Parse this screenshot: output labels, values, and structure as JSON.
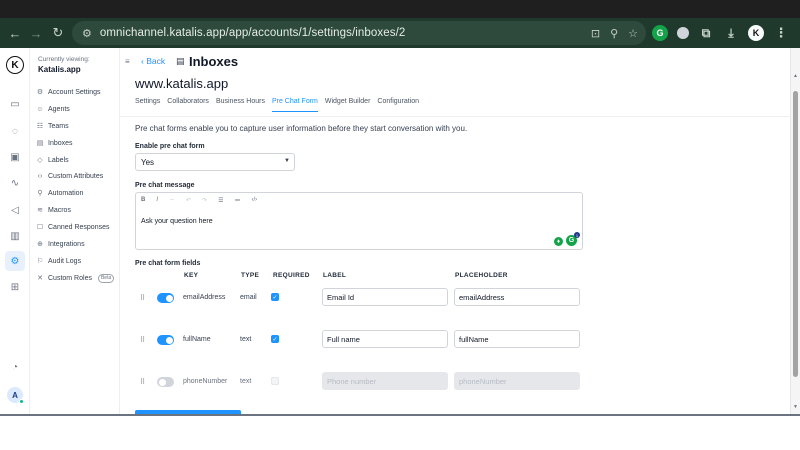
{
  "browser": {
    "url": "omnichannel.katalis.app/app/accounts/1/settings/inboxes/2"
  },
  "rail": {
    "logo_letter": "K",
    "avatar_letter": "A"
  },
  "sidebar": {
    "viewing_label": "Currently viewing:",
    "account_name": "Katalis.app",
    "items": [
      {
        "label": "Account Settings",
        "icon": "⚙"
      },
      {
        "label": "Agents",
        "icon": "☺"
      },
      {
        "label": "Teams",
        "icon": "☷"
      },
      {
        "label": "Inboxes",
        "icon": "▤"
      },
      {
        "label": "Labels",
        "icon": "◇"
      },
      {
        "label": "Custom Attributes",
        "icon": "‹›"
      },
      {
        "label": "Automation",
        "icon": "⚲"
      },
      {
        "label": "Macros",
        "icon": "≋"
      },
      {
        "label": "Canned Responses",
        "icon": "☐"
      },
      {
        "label": "Integrations",
        "icon": "⊕"
      },
      {
        "label": "Audit Logs",
        "icon": "⚐"
      },
      {
        "label": "Custom Roles",
        "icon": "✕"
      }
    ],
    "beta_badge": "Beta"
  },
  "header": {
    "back_label": "Back",
    "title": "Inboxes",
    "inbox_name": "www.katalis.app"
  },
  "tabs": [
    "Settings",
    "Collaborators",
    "Business Hours",
    "Pre Chat Form",
    "Widget Builder",
    "Configuration"
  ],
  "active_tab": "Pre Chat Form",
  "form": {
    "intro": "Pre chat forms enable you to capture user information before they start conversation with you.",
    "enable_label": "Enable pre chat form",
    "enable_value": "Yes",
    "message_label": "Pre chat message",
    "message_value": "Ask your question here",
    "editor_tools": [
      "B",
      "I",
      "⇔",
      "↶",
      "↷",
      "☰",
      "≔",
      "‹/›"
    ],
    "fields_title": "Pre chat form fields",
    "columns": {
      "key": "KEY",
      "type": "TYPE",
      "required": "REQUIRED",
      "label": "LABEL",
      "placeholder": "PLACEHOLDER"
    },
    "rows": [
      {
        "key": "emailAddress",
        "type": "email",
        "enabled": true,
        "required": true,
        "label": "Email Id",
        "placeholder": "emailAddress"
      },
      {
        "key": "fullName",
        "type": "text",
        "enabled": true,
        "required": true,
        "label": "Full name",
        "placeholder": "fullName"
      },
      {
        "key": "phoneNumber",
        "type": "text",
        "enabled": false,
        "required": false,
        "label": "Phone number",
        "placeholder": "phoneNumber"
      }
    ]
  },
  "colors": {
    "accent": "#1f93ff",
    "chrome": "#1f3a2d",
    "grammarly": "#15a34a"
  }
}
